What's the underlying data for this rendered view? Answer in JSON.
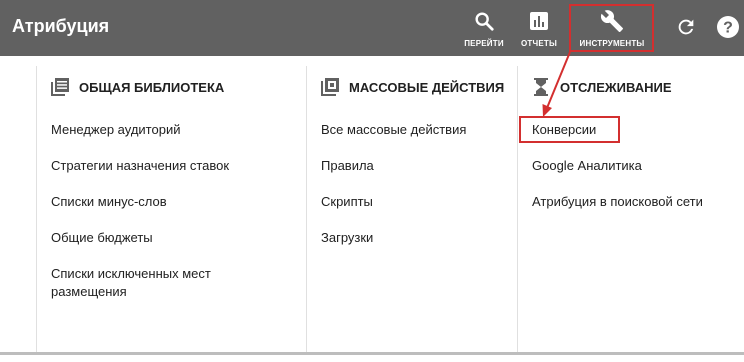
{
  "header": {
    "title": "Атрибуция",
    "buttons": {
      "go": {
        "label": "ПЕРЕЙТИ",
        "icon": "search-icon"
      },
      "reports": {
        "label": "ОТЧЕТЫ",
        "icon": "bar-chart-icon"
      },
      "tools": {
        "label": "ИНСТРУМЕНТЫ",
        "icon": "wrench-icon"
      },
      "refresh": {
        "icon": "refresh-icon"
      },
      "help": {
        "icon": "help-icon"
      }
    }
  },
  "menu": {
    "columns": [
      {
        "title": "ОБЩАЯ БИБЛИОТЕКА",
        "icon": "library-icon",
        "items": [
          "Менеджер аудиторий",
          "Стратегии назначения ставок",
          "Списки минус-слов",
          "Общие бюджеты",
          "Списки исключенных мест размещения"
        ]
      },
      {
        "title": "МАССОВЫЕ ДЕЙСТВИЯ",
        "icon": "bulk-actions-icon",
        "items": [
          "Все массовые действия",
          "Правила",
          "Скрипты",
          "Загрузки"
        ]
      },
      {
        "title": "ОТСЛЕЖИВАНИЕ",
        "icon": "hourglass-icon",
        "items": [
          "Конверсии",
          "Google Аналитика",
          "Атрибуция в поисковой сети"
        ]
      }
    ]
  },
  "colors": {
    "topbar": "#616161",
    "highlight": "#d32f2f"
  }
}
